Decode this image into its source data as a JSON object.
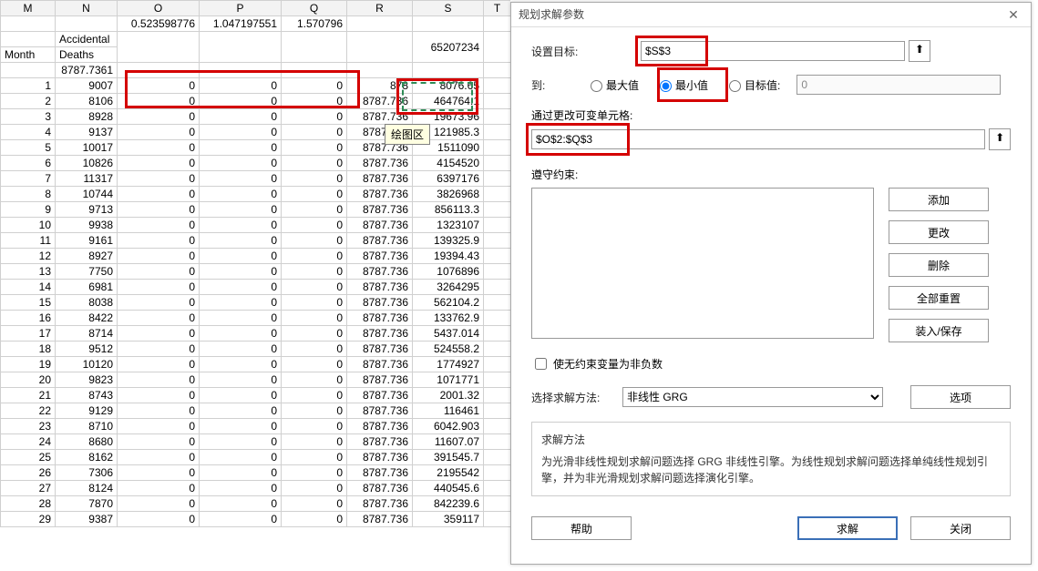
{
  "columns": [
    "M",
    "N",
    "O",
    "P",
    "Q",
    "R",
    "S",
    "T"
  ],
  "row2": {
    "O": "0.523598776",
    "P": "1.047197551",
    "Q": "1.570796"
  },
  "row3": {
    "M": "Month",
    "N_top": "Accidental",
    "N_bot": "Deaths",
    "S": "65207234"
  },
  "row4": {
    "N": "8787.7361"
  },
  "tooltip": "绘图区",
  "rows": [
    {
      "M": "1",
      "N": "9007",
      "O": "0",
      "P": "0",
      "Q": "0",
      "R": "878",
      "S": "8076.65"
    },
    {
      "M": "2",
      "N": "8106",
      "O": "0",
      "P": "0",
      "Q": "0",
      "R": "8787.736",
      "S": "464764.1"
    },
    {
      "M": "3",
      "N": "8928",
      "O": "0",
      "P": "0",
      "Q": "0",
      "R": "8787.736",
      "S": "19673.96"
    },
    {
      "M": "4",
      "N": "9137",
      "O": "0",
      "P": "0",
      "Q": "0",
      "R": "8787.736",
      "S": "121985.3"
    },
    {
      "M": "5",
      "N": "10017",
      "O": "0",
      "P": "0",
      "Q": "0",
      "R": "8787.736",
      "S": "1511090"
    },
    {
      "M": "6",
      "N": "10826",
      "O": "0",
      "P": "0",
      "Q": "0",
      "R": "8787.736",
      "S": "4154520"
    },
    {
      "M": "7",
      "N": "11317",
      "O": "0",
      "P": "0",
      "Q": "0",
      "R": "8787.736",
      "S": "6397176"
    },
    {
      "M": "8",
      "N": "10744",
      "O": "0",
      "P": "0",
      "Q": "0",
      "R": "8787.736",
      "S": "3826968"
    },
    {
      "M": "9",
      "N": "9713",
      "O": "0",
      "P": "0",
      "Q": "0",
      "R": "8787.736",
      "S": "856113.3"
    },
    {
      "M": "10",
      "N": "9938",
      "O": "0",
      "P": "0",
      "Q": "0",
      "R": "8787.736",
      "S": "1323107"
    },
    {
      "M": "11",
      "N": "9161",
      "O": "0",
      "P": "0",
      "Q": "0",
      "R": "8787.736",
      "S": "139325.9"
    },
    {
      "M": "12",
      "N": "8927",
      "O": "0",
      "P": "0",
      "Q": "0",
      "R": "8787.736",
      "S": "19394.43"
    },
    {
      "M": "13",
      "N": "7750",
      "O": "0",
      "P": "0",
      "Q": "0",
      "R": "8787.736",
      "S": "1076896"
    },
    {
      "M": "14",
      "N": "6981",
      "O": "0",
      "P": "0",
      "Q": "0",
      "R": "8787.736",
      "S": "3264295"
    },
    {
      "M": "15",
      "N": "8038",
      "O": "0",
      "P": "0",
      "Q": "0",
      "R": "8787.736",
      "S": "562104.2"
    },
    {
      "M": "16",
      "N": "8422",
      "O": "0",
      "P": "0",
      "Q": "0",
      "R": "8787.736",
      "S": "133762.9"
    },
    {
      "M": "17",
      "N": "8714",
      "O": "0",
      "P": "0",
      "Q": "0",
      "R": "8787.736",
      "S": "5437.014"
    },
    {
      "M": "18",
      "N": "9512",
      "O": "0",
      "P": "0",
      "Q": "0",
      "R": "8787.736",
      "S": "524558.2"
    },
    {
      "M": "19",
      "N": "10120",
      "O": "0",
      "P": "0",
      "Q": "0",
      "R": "8787.736",
      "S": "1774927"
    },
    {
      "M": "20",
      "N": "9823",
      "O": "0",
      "P": "0",
      "Q": "0",
      "R": "8787.736",
      "S": "1071771"
    },
    {
      "M": "21",
      "N": "8743",
      "O": "0",
      "P": "0",
      "Q": "0",
      "R": "8787.736",
      "S": "2001.32"
    },
    {
      "M": "22",
      "N": "9129",
      "O": "0",
      "P": "0",
      "Q": "0",
      "R": "8787.736",
      "S": "116461"
    },
    {
      "M": "23",
      "N": "8710",
      "O": "0",
      "P": "0",
      "Q": "0",
      "R": "8787.736",
      "S": "6042.903"
    },
    {
      "M": "24",
      "N": "8680",
      "O": "0",
      "P": "0",
      "Q": "0",
      "R": "8787.736",
      "S": "11607.07"
    },
    {
      "M": "25",
      "N": "8162",
      "O": "0",
      "P": "0",
      "Q": "0",
      "R": "8787.736",
      "S": "391545.7"
    },
    {
      "M": "26",
      "N": "7306",
      "O": "0",
      "P": "0",
      "Q": "0",
      "R": "8787.736",
      "S": "2195542"
    },
    {
      "M": "27",
      "N": "8124",
      "O": "0",
      "P": "0",
      "Q": "0",
      "R": "8787.736",
      "S": "440545.6"
    },
    {
      "M": "28",
      "N": "7870",
      "O": "0",
      "P": "0",
      "Q": "0",
      "R": "8787.736",
      "S": "842239.6"
    },
    {
      "M": "29",
      "N": "9387",
      "O": "0",
      "P": "0",
      "Q": "0",
      "R": "8787.736",
      "S": "359117"
    }
  ],
  "dialog": {
    "title": "规划求解参数",
    "setObjective": "设置目标:",
    "objectiveValue": "$S$3",
    "toLabel": "到:",
    "radioMax": "最大值",
    "radioMin": "最小值",
    "radioValueOf": "目标值:",
    "valueOfField": "0",
    "byChanging": "通过更改可变单元格:",
    "changingValue": "$O$2:$Q$3",
    "subjectTo": "遵守约束:",
    "btnAdd": "添加",
    "btnChange": "更改",
    "btnDelete": "删除",
    "btnResetAll": "全部重置",
    "btnLoadSave": "装入/保存",
    "nonNeg": "使无约束变量为非负数",
    "selectMethod": "选择求解方法:",
    "methodValue": "非线性 GRG",
    "btnOptions": "选项",
    "helpTitle": "求解方法",
    "helpText": "为光滑非线性规划求解问题选择 GRG 非线性引擎。为线性规划求解问题选择单纯线性规划引擎，并为非光滑规划求解问题选择演化引擎。",
    "btnHelp": "帮助",
    "btnSolve": "求解",
    "btnClose": "关闭"
  }
}
